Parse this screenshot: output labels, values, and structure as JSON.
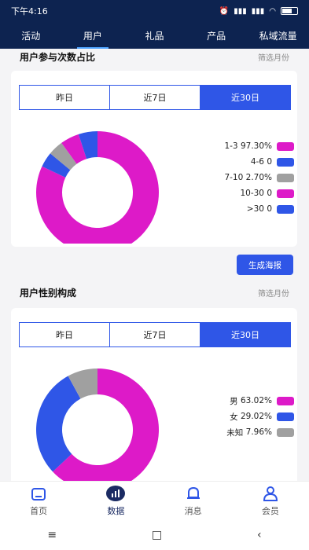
{
  "status": {
    "time": "下午4:16"
  },
  "tabs": [
    "活动",
    "用户",
    "礼品",
    "产品",
    "私域流量"
  ],
  "section1": {
    "title": "用户参与次数占比",
    "filter": "筛选月份",
    "segments": [
      "昨日",
      "近7日",
      "近30日"
    ],
    "legend": [
      {
        "label": "1-3",
        "value": "97.30%",
        "color": "#dd1ac8"
      },
      {
        "label": "4-6",
        "value": "0",
        "color": "#2f56e7"
      },
      {
        "label": "7-10",
        "value": "2.70%",
        "color": "#a0a0a0"
      },
      {
        "label": "10-30",
        "value": "0",
        "color": "#dd1ac8"
      },
      {
        "label": ">30",
        "value": "0",
        "color": "#2f56e7"
      }
    ],
    "poster_button": "生成海报"
  },
  "section2": {
    "title": "用户性别构成",
    "filter": "筛选月份",
    "segments": [
      "昨日",
      "近7日",
      "近30日"
    ],
    "legend": [
      {
        "label": "男",
        "value": "63.02%",
        "color": "#dd1ac8"
      },
      {
        "label": "女",
        "value": "29.02%",
        "color": "#2f56e7"
      },
      {
        "label": "未知",
        "value": "7.96%",
        "color": "#a0a0a0"
      }
    ]
  },
  "chart_data": [
    {
      "type": "pie",
      "categories": [
        "1-3",
        "4-6",
        "7-10",
        "10-30",
        ">30"
      ],
      "values": [
        82,
        4,
        4,
        5,
        5
      ],
      "colors": [
        "#dd1ac8",
        "#2f56e7",
        "#a0a0a0",
        "#dd1ac8",
        "#2f56e7"
      ],
      "donut": true
    },
    {
      "type": "pie",
      "categories": [
        "男",
        "女",
        "未知"
      ],
      "values": [
        63.02,
        29.02,
        7.96
      ],
      "colors": [
        "#dd1ac8",
        "#2f56e7",
        "#a0a0a0"
      ],
      "donut": true
    }
  ],
  "bottom_nav": [
    {
      "label": "首页",
      "icon": "home-icon"
    },
    {
      "label": "数据",
      "icon": "data-chart-icon"
    },
    {
      "label": "消息",
      "icon": "bell-icon"
    },
    {
      "label": "会员",
      "icon": "user-icon"
    }
  ],
  "system_nav": {
    "menu": "≡",
    "home": "□",
    "back": "‹"
  }
}
